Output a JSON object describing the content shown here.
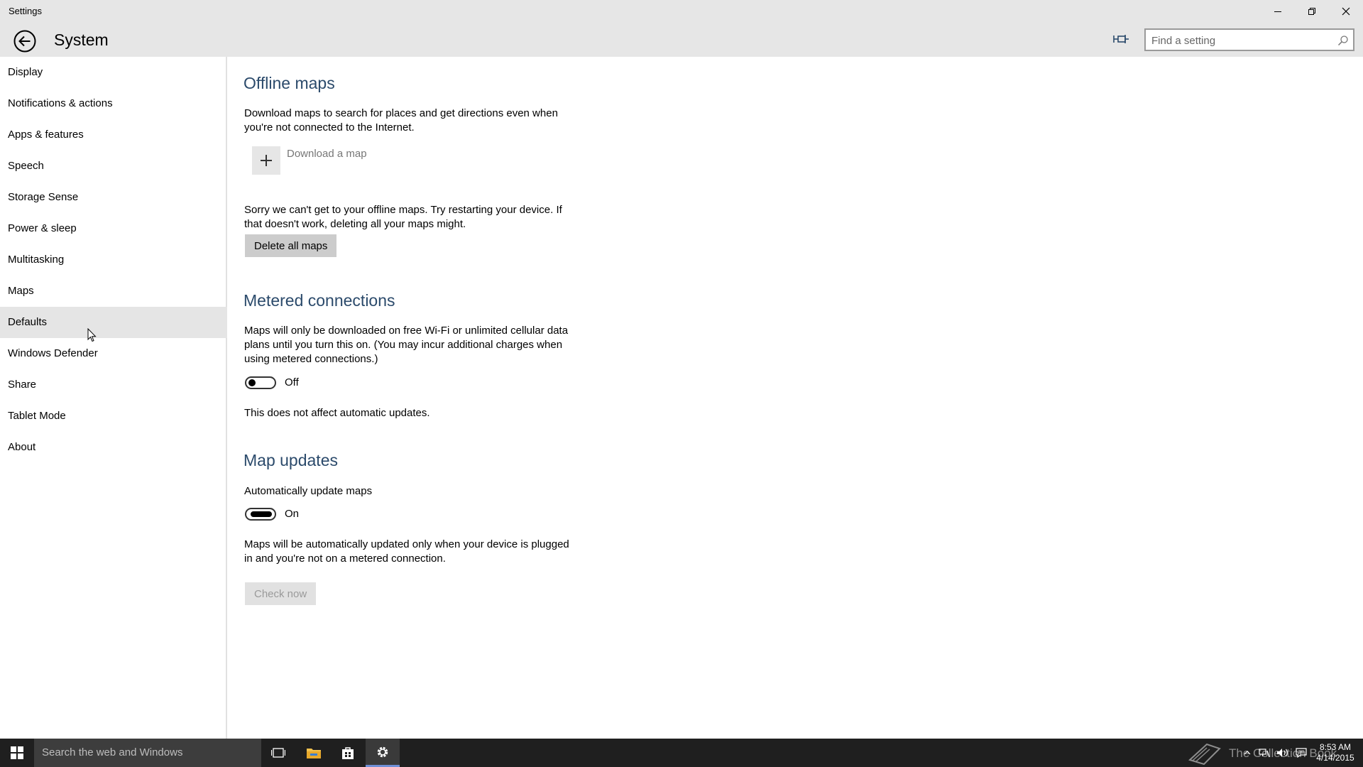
{
  "window": {
    "app_title": "Settings",
    "page_title": "System",
    "search_placeholder": "Find a setting"
  },
  "sidebar": {
    "items": [
      {
        "label": "Display"
      },
      {
        "label": "Notifications & actions"
      },
      {
        "label": "Apps & features"
      },
      {
        "label": "Speech"
      },
      {
        "label": "Storage Sense"
      },
      {
        "label": "Power & sleep"
      },
      {
        "label": "Multitasking"
      },
      {
        "label": "Maps"
      },
      {
        "label": "Defaults",
        "selected": true
      },
      {
        "label": "Windows Defender"
      },
      {
        "label": "Share"
      },
      {
        "label": "Tablet Mode"
      },
      {
        "label": "About"
      }
    ]
  },
  "offline_maps": {
    "heading": "Offline maps",
    "description": "Download maps to search for places and get directions even when you're not connected to the Internet.",
    "download_label": "Download a map",
    "error_text": "Sorry we can't get to your offline maps. Try restarting your device. If that doesn't work, deleting all your maps might.",
    "delete_button": "Delete all maps"
  },
  "metered": {
    "heading": "Metered connections",
    "description": "Maps will only be downloaded on free Wi-Fi or unlimited cellular data plans until you turn this on. (You may incur additional charges when using metered connections.)",
    "toggle_state": "Off",
    "note": "This does not affect automatic updates."
  },
  "map_updates": {
    "heading": "Map updates",
    "toggle_title": "Automatically update maps",
    "toggle_state": "On",
    "description": "Maps will be automatically updated only when your device is plugged in and you're not on a metered connection.",
    "check_button": "Check now"
  },
  "taskbar": {
    "search_placeholder": "Search the web and Windows",
    "watermark": "The Collection Book",
    "time": "8:53 AM",
    "date": "4/14/2015",
    "accent_color": "#6f8fd6"
  },
  "colors": {
    "heading": "#2b4a6b",
    "header_bg": "#e6e6e6",
    "selected_item_bg": "#e5e5e5",
    "taskbar_bg": "#1f1f1f"
  }
}
